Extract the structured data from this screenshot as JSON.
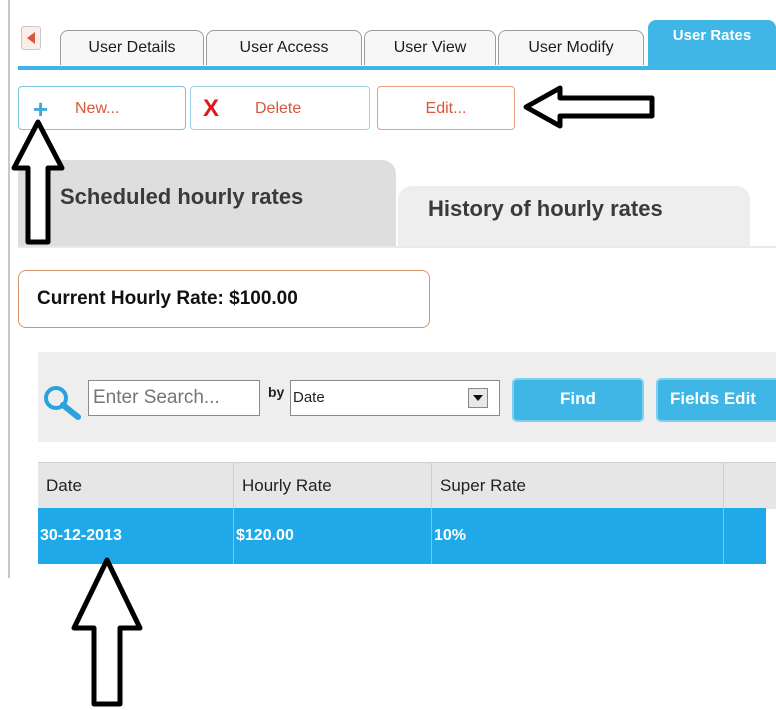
{
  "top_tabs": [
    "User Details",
    "User Access",
    "User View",
    "User Modify",
    "User Rates"
  ],
  "toolbar": {
    "new_label": "New...",
    "delete_label": "Delete",
    "edit_label": "Edit..."
  },
  "sub_tabs": {
    "scheduled": "Scheduled hourly rates",
    "history": "History of hourly rates"
  },
  "current_rate": "Current Hourly Rate: $100.00",
  "search": {
    "placeholder": "Enter Search...",
    "by_label": "by",
    "by_value": "Date",
    "find_label": "Find",
    "fields_label": "Fields Edit"
  },
  "table": {
    "headers": [
      "Date",
      "Hourly Rate",
      "Super Rate"
    ],
    "rows": [
      {
        "date": "30-12-2013",
        "hourly_rate": "$120.00",
        "super_rate": "10%"
      }
    ]
  },
  "colors": {
    "accent": "#3fb6e6",
    "selected_row": "#1fa9e9",
    "delete_red": "#e0161b"
  },
  "icons": {
    "back": "left-arrow-icon",
    "new": "plus-icon",
    "delete": "x-icon",
    "search": "search-icon",
    "dropdown": "chevron-down-icon"
  }
}
